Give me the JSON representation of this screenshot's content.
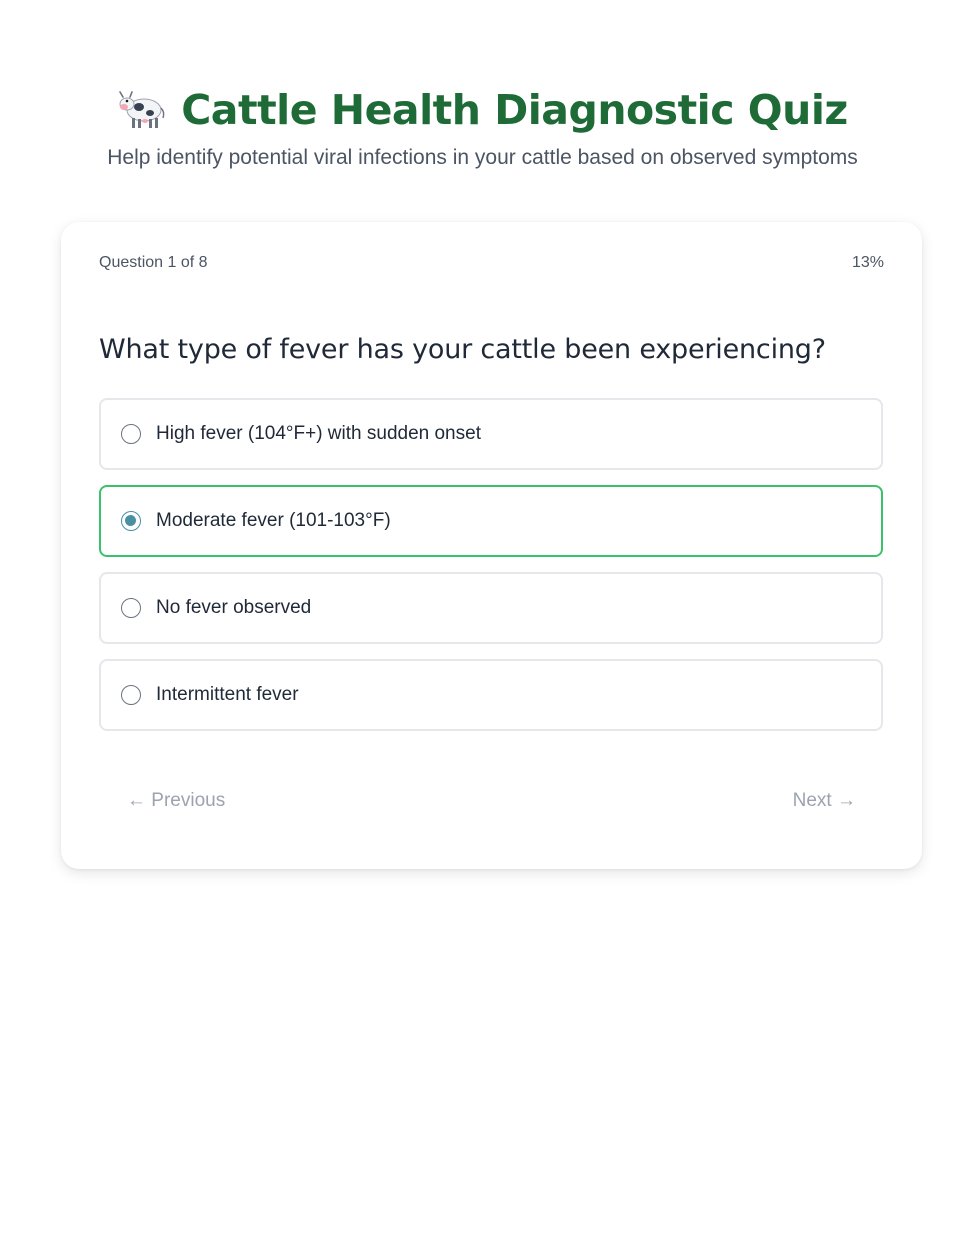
{
  "header": {
    "icon": "cow-icon",
    "title": "Cattle Health Diagnostic Quiz",
    "subtitle": "Help identify potential viral infections in your cattle based on observed symptoms"
  },
  "quiz": {
    "progress_text": "Question 1 of 8",
    "progress_percent_text": "13%",
    "progress_fraction": 0.13,
    "question": "What type of fever has your cattle been experiencing?",
    "options": [
      {
        "label": "High fever (104°F+) with sudden onset",
        "selected": false
      },
      {
        "label": "Moderate fever (101-103°F)",
        "selected": true
      },
      {
        "label": "No fever observed",
        "selected": false
      },
      {
        "label": "Intermittent fever",
        "selected": false
      }
    ],
    "prev_label": "← Previous",
    "next_label": "Next →"
  },
  "colors": {
    "title": "#1e6b37",
    "selected_border": "#3cc16b",
    "radio_selected": "#4a90a4",
    "nav_text": "#9ca3af"
  }
}
